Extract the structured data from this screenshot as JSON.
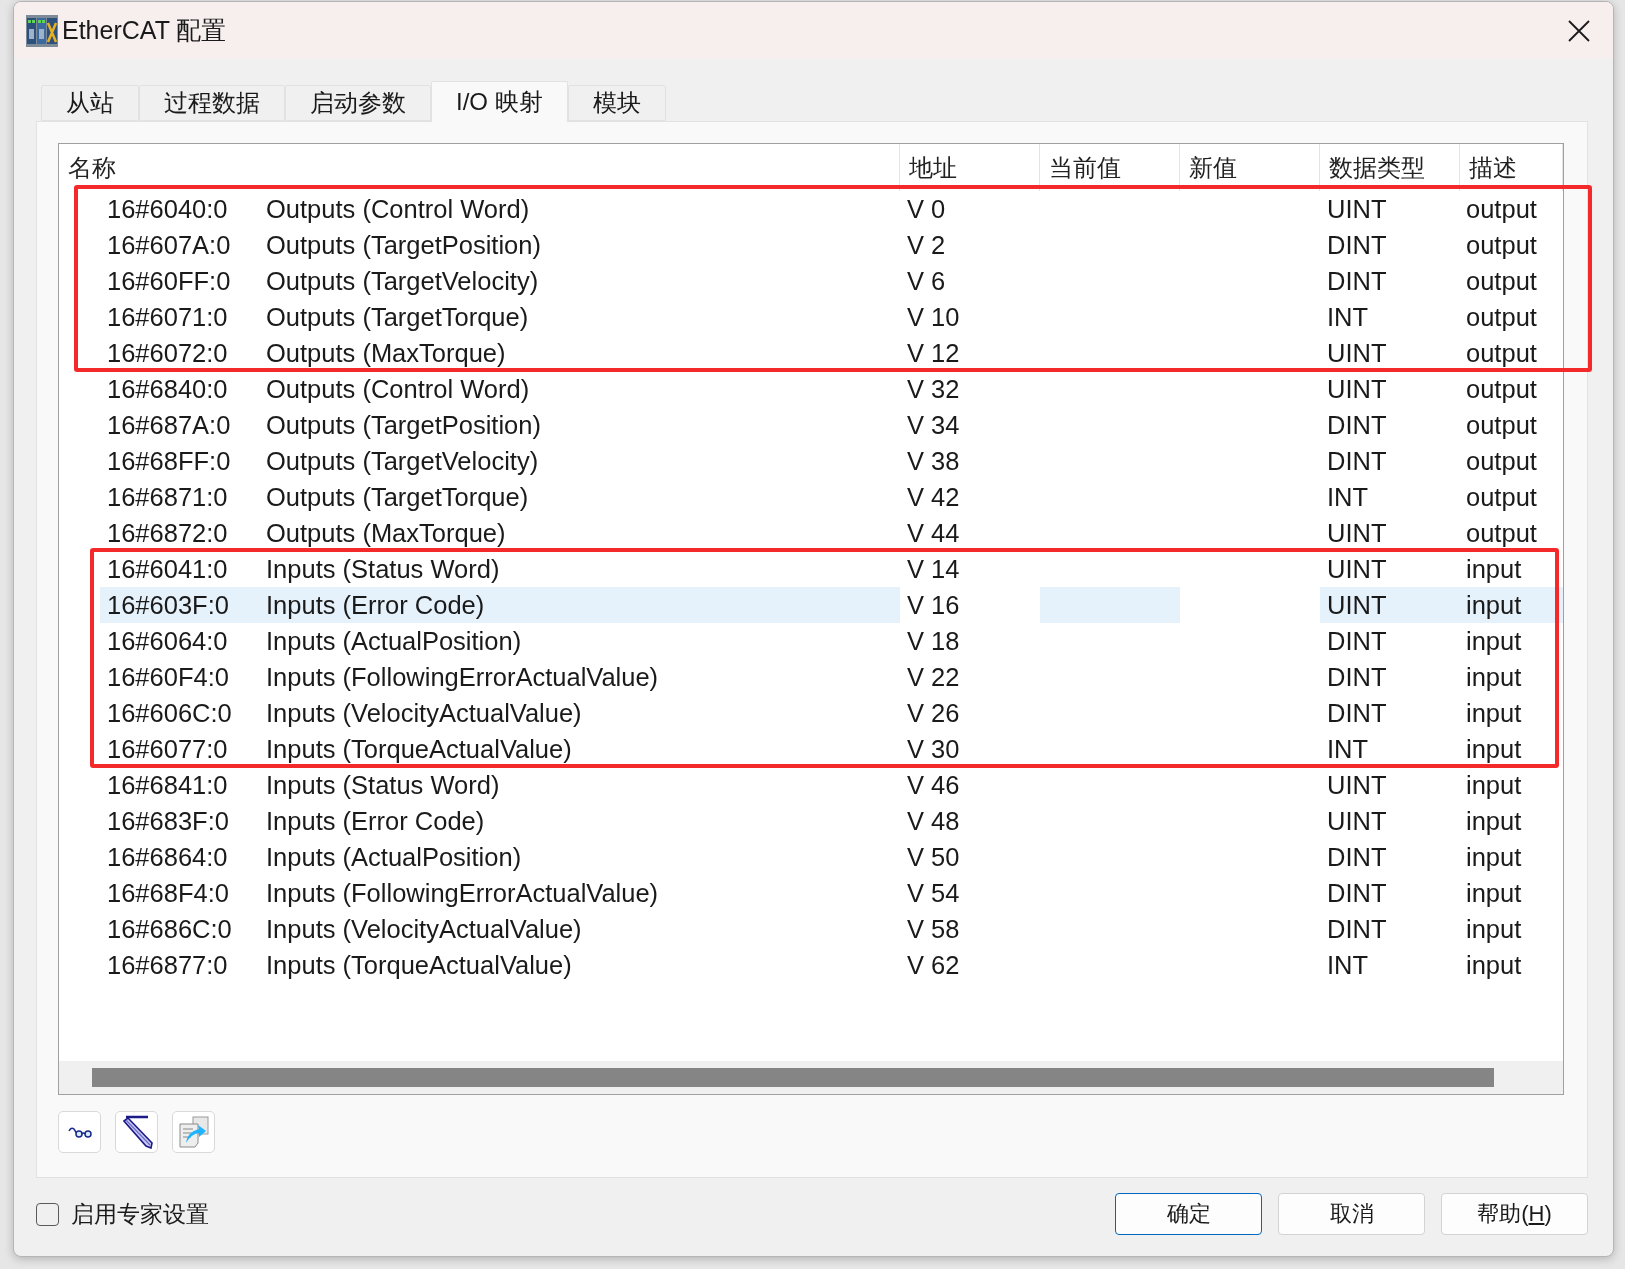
{
  "window": {
    "title": "EtherCAT 配置"
  },
  "tabs": [
    {
      "label": "从站",
      "selected": false
    },
    {
      "label": "过程数据",
      "selected": false
    },
    {
      "label": "启动参数",
      "selected": false
    },
    {
      "label": "I/O 映射",
      "selected": true
    },
    {
      "label": "模块",
      "selected": false
    }
  ],
  "table": {
    "columns": [
      "名称",
      "地址",
      "当前值",
      "新值",
      "数据类型",
      "描述"
    ],
    "row_groups": [
      {
        "framed": true,
        "rows": [
          {
            "index": "16#6040:0",
            "name": "Outputs (Control Word)",
            "address": "V 0",
            "data_type": "UINT",
            "description": "output",
            "selected": false
          },
          {
            "index": "16#607A:0",
            "name": "Outputs (TargetPosition)",
            "address": "V 2",
            "data_type": "DINT",
            "description": "output",
            "selected": false
          },
          {
            "index": "16#60FF:0",
            "name": "Outputs (TargetVelocity)",
            "address": "V 6",
            "data_type": "DINT",
            "description": "output",
            "selected": false
          },
          {
            "index": "16#6071:0",
            "name": "Outputs (TargetTorque)",
            "address": "V 10",
            "data_type": "INT",
            "description": "output",
            "selected": false
          },
          {
            "index": "16#6072:0",
            "name": "Outputs (MaxTorque)",
            "address": "V 12",
            "data_type": "UINT",
            "description": "output",
            "selected": false
          }
        ]
      },
      {
        "framed": false,
        "rows": [
          {
            "index": "16#6840:0",
            "name": "Outputs (Control Word)",
            "address": "V 32",
            "data_type": "UINT",
            "description": "output",
            "selected": false
          },
          {
            "index": "16#687A:0",
            "name": "Outputs (TargetPosition)",
            "address": "V 34",
            "data_type": "DINT",
            "description": "output",
            "selected": false
          },
          {
            "index": "16#68FF:0",
            "name": "Outputs (TargetVelocity)",
            "address": "V 38",
            "data_type": "DINT",
            "description": "output",
            "selected": false
          },
          {
            "index": "16#6871:0",
            "name": "Outputs (TargetTorque)",
            "address": "V 42",
            "data_type": "INT",
            "description": "output",
            "selected": false
          },
          {
            "index": "16#6872:0",
            "name": "Outputs (MaxTorque)",
            "address": "V 44",
            "data_type": "UINT",
            "description": "output",
            "selected": false
          }
        ]
      },
      {
        "framed": true,
        "rows": [
          {
            "index": "16#6041:0",
            "name": "Inputs (Status Word)",
            "address": "V 14",
            "data_type": "UINT",
            "description": "input",
            "selected": false
          },
          {
            "index": "16#603F:0",
            "name": "Inputs (Error Code)",
            "address": "V 16",
            "data_type": "UINT",
            "description": "input",
            "selected": true
          },
          {
            "index": "16#6064:0",
            "name": "Inputs (ActualPosition)",
            "address": "V 18",
            "data_type": "DINT",
            "description": "input",
            "selected": false
          },
          {
            "index": "16#60F4:0",
            "name": "Inputs (FollowingErrorActualValue)",
            "address": "V 22",
            "data_type": "DINT",
            "description": "input",
            "selected": false
          },
          {
            "index": "16#606C:0",
            "name": "Inputs (VelocityActualValue)",
            "address": "V 26",
            "data_type": "DINT",
            "description": "input",
            "selected": false
          },
          {
            "index": "16#6077:0",
            "name": "Inputs (TorqueActualValue)",
            "address": "V 30",
            "data_type": "INT",
            "description": "input",
            "selected": false
          }
        ]
      },
      {
        "framed": false,
        "rows": [
          {
            "index": "16#6841:0",
            "name": "Inputs (Status Word)",
            "address": "V 46",
            "data_type": "UINT",
            "description": "input",
            "selected": false
          },
          {
            "index": "16#683F:0",
            "name": "Inputs (Error Code)",
            "address": "V 48",
            "data_type": "UINT",
            "description": "input",
            "selected": false
          },
          {
            "index": "16#6864:0",
            "name": "Inputs (ActualPosition)",
            "address": "V 50",
            "data_type": "DINT",
            "description": "input",
            "selected": false
          },
          {
            "index": "16#68F4:0",
            "name": "Inputs (FollowingErrorActualValue)",
            "address": "V 54",
            "data_type": "DINT",
            "description": "input",
            "selected": false
          },
          {
            "index": "16#686C:0",
            "name": "Inputs (VelocityActualValue)",
            "address": "V 58",
            "data_type": "DINT",
            "description": "input",
            "selected": false
          },
          {
            "index": "16#6877:0",
            "name": "Inputs (TorqueActualValue)",
            "address": "V 62",
            "data_type": "INT",
            "description": "input",
            "selected": false
          }
        ]
      }
    ]
  },
  "expert_settings": {
    "label": "启用专家设置",
    "checked": false
  },
  "buttons": [
    {
      "label": "确定",
      "default": true
    },
    {
      "label": "取消",
      "default": false
    },
    {
      "label": "帮助(",
      "access_key": "H",
      "label_end": ")",
      "default": false
    }
  ]
}
